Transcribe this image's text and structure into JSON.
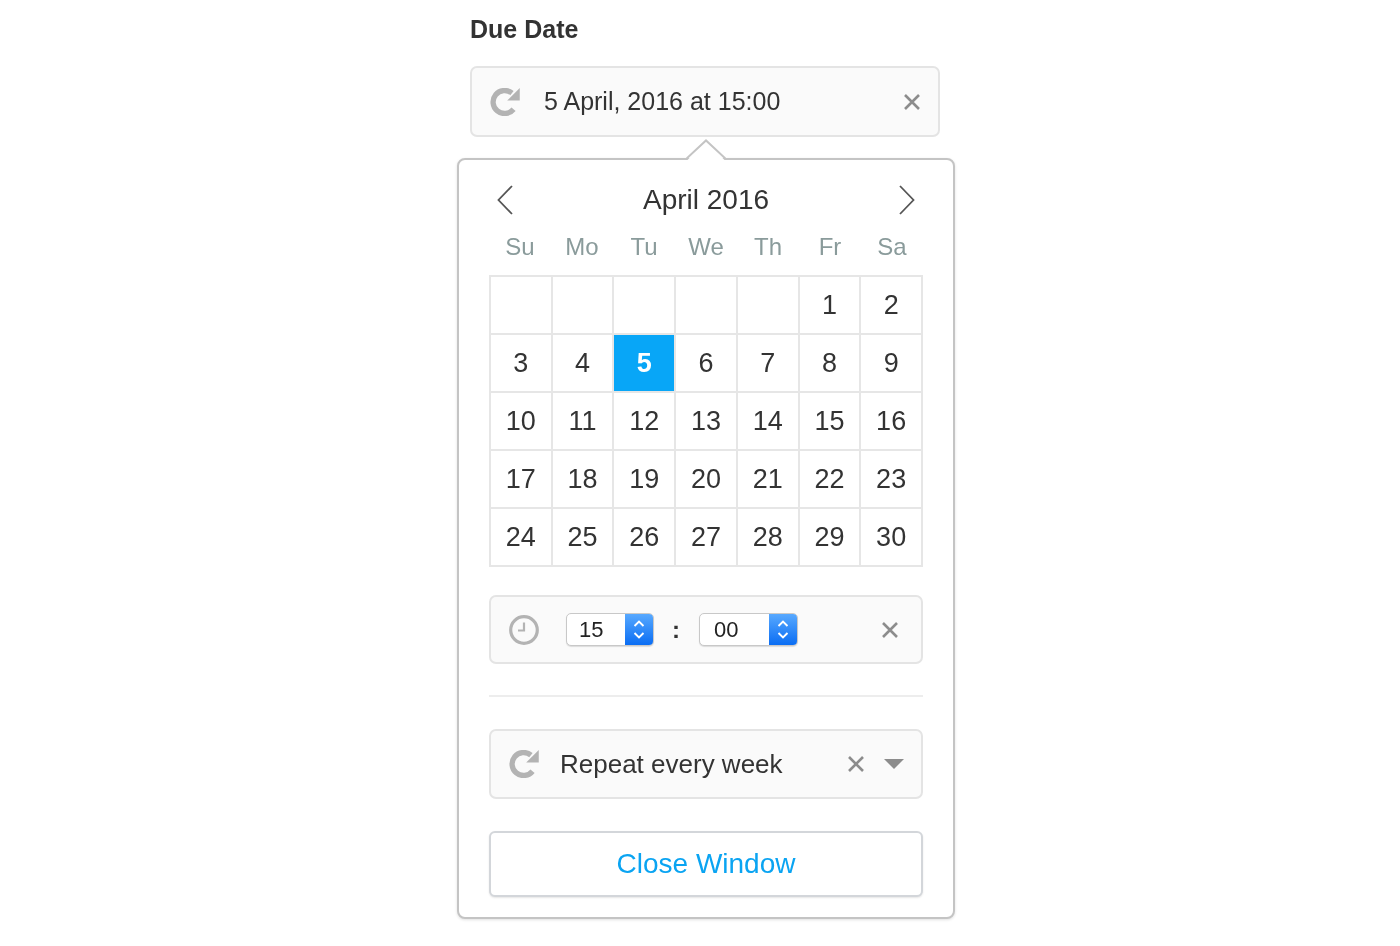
{
  "due_date": {
    "label": "Due Date",
    "value": "5 April, 2016 at 15:00"
  },
  "calendar": {
    "title": "April 2016",
    "weekdays": [
      "Su",
      "Mo",
      "Tu",
      "We",
      "Th",
      "Fr",
      "Sa"
    ],
    "weeks": [
      [
        {
          "kind": "blank"
        },
        {
          "kind": "blank"
        },
        {
          "kind": "blank"
        },
        {
          "kind": "blank"
        },
        {
          "kind": "blank"
        },
        {
          "kind": "day",
          "day": "1",
          "selected": false
        },
        {
          "kind": "day",
          "day": "2",
          "selected": false
        }
      ],
      [
        {
          "kind": "day",
          "day": "3",
          "selected": false
        },
        {
          "kind": "day",
          "day": "4",
          "selected": false
        },
        {
          "kind": "day",
          "day": "5",
          "selected": true
        },
        {
          "kind": "day",
          "day": "6",
          "selected": false
        },
        {
          "kind": "day",
          "day": "7",
          "selected": false
        },
        {
          "kind": "day",
          "day": "8",
          "selected": false
        },
        {
          "kind": "day",
          "day": "9",
          "selected": false
        }
      ],
      [
        {
          "kind": "day",
          "day": "10",
          "selected": false
        },
        {
          "kind": "day",
          "day": "11",
          "selected": false
        },
        {
          "kind": "day",
          "day": "12",
          "selected": false
        },
        {
          "kind": "day",
          "day": "13",
          "selected": false
        },
        {
          "kind": "day",
          "day": "14",
          "selected": false
        },
        {
          "kind": "day",
          "day": "15",
          "selected": false
        },
        {
          "kind": "day",
          "day": "16",
          "selected": false
        }
      ],
      [
        {
          "kind": "day",
          "day": "17",
          "selected": false
        },
        {
          "kind": "day",
          "day": "18",
          "selected": false
        },
        {
          "kind": "day",
          "day": "19",
          "selected": false
        },
        {
          "kind": "day",
          "day": "20",
          "selected": false
        },
        {
          "kind": "day",
          "day": "21",
          "selected": false
        },
        {
          "kind": "day",
          "day": "22",
          "selected": false
        },
        {
          "kind": "day",
          "day": "23",
          "selected": false
        }
      ],
      [
        {
          "kind": "day",
          "day": "24",
          "selected": false
        },
        {
          "kind": "day",
          "day": "25",
          "selected": false
        },
        {
          "kind": "day",
          "day": "26",
          "selected": false
        },
        {
          "kind": "day",
          "day": "27",
          "selected": false
        },
        {
          "kind": "day",
          "day": "28",
          "selected": false
        },
        {
          "kind": "day",
          "day": "29",
          "selected": false
        },
        {
          "kind": "day",
          "day": "30",
          "selected": false
        }
      ]
    ]
  },
  "time": {
    "hour": "15",
    "separator": ":",
    "minute": "00"
  },
  "repeat": {
    "value": "Repeat every week"
  },
  "close_button": {
    "label": "Close Window"
  }
}
